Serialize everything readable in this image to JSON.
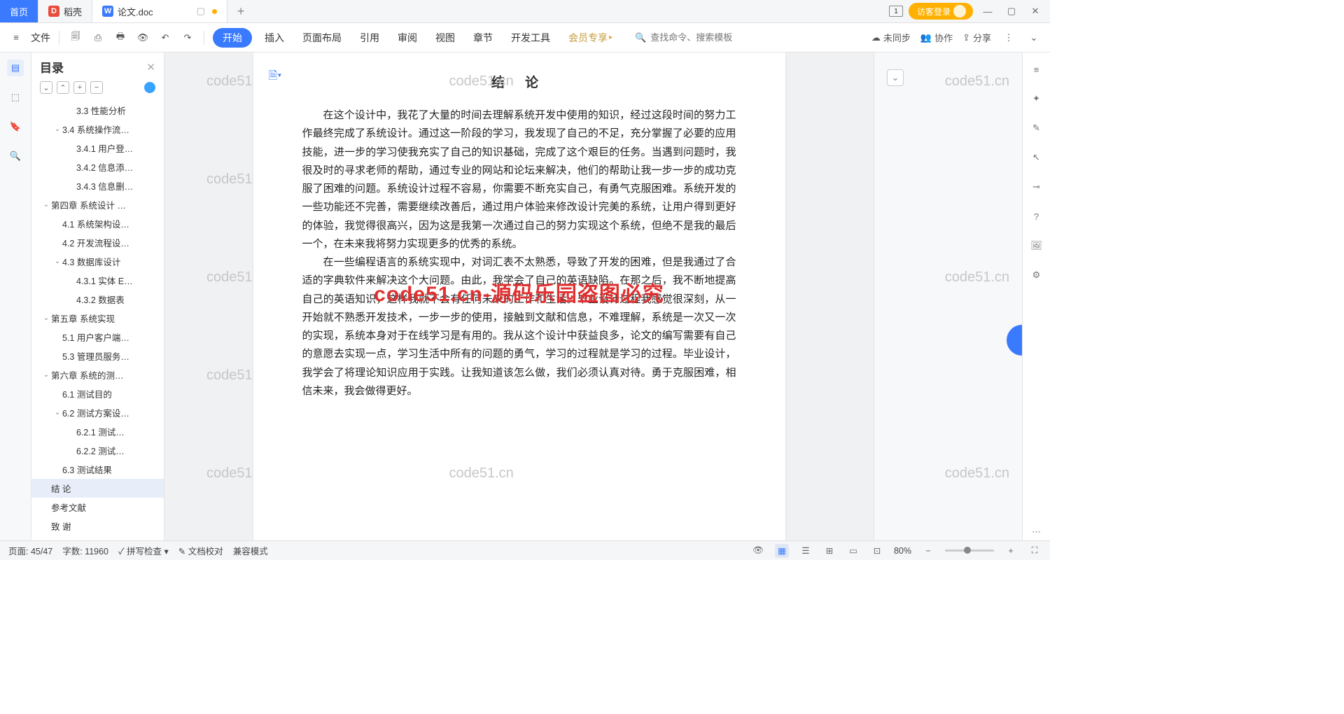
{
  "titlebar": {
    "home": "首页",
    "daoke": "稻壳",
    "docname": "论文.doc",
    "newtab": "+",
    "window_count": "1",
    "login": "访客登录"
  },
  "toolbar": {
    "file": "文件",
    "menus": [
      "开始",
      "插入",
      "页面布局",
      "引用",
      "审阅",
      "视图",
      "章节",
      "开发工具",
      "会员专享"
    ],
    "search_placeholder": "查找命令、搜索模板",
    "unsync": "未同步",
    "coop": "协作",
    "share": "分享"
  },
  "sidebar": {
    "title": "目录",
    "items": [
      {
        "lvl": 2,
        "txt": "3.3 性能分析",
        "chev": ""
      },
      {
        "lvl": 1,
        "txt": "3.4 系统操作流…",
        "chev": "⌄"
      },
      {
        "lvl": 2,
        "txt": "3.4.1 用户登…",
        "chev": ""
      },
      {
        "lvl": 2,
        "txt": "3.4.2 信息添…",
        "chev": ""
      },
      {
        "lvl": 2,
        "txt": "3.4.3 信息删…",
        "chev": ""
      },
      {
        "lvl": 0,
        "txt": "第四章  系统设计 …",
        "chev": "⌄"
      },
      {
        "lvl": 1,
        "txt": "4.1 系统架构设…",
        "chev": ""
      },
      {
        "lvl": 1,
        "txt": "4.2 开发流程设…",
        "chev": ""
      },
      {
        "lvl": 1,
        "txt": "4.3 数据库设计",
        "chev": "⌄"
      },
      {
        "lvl": 2,
        "txt": "4.3.1 实体 E…",
        "chev": ""
      },
      {
        "lvl": 2,
        "txt": "4.3.2 数据表",
        "chev": ""
      },
      {
        "lvl": 0,
        "txt": "第五章  系统实现",
        "chev": "⌄"
      },
      {
        "lvl": 1,
        "txt": "5.1 用户客户端…",
        "chev": ""
      },
      {
        "lvl": 1,
        "txt": "5.3 管理员服务…",
        "chev": ""
      },
      {
        "lvl": 0,
        "txt": "第六章   系统的测…",
        "chev": "⌄"
      },
      {
        "lvl": 1,
        "txt": "6.1 测试目的",
        "chev": ""
      },
      {
        "lvl": 1,
        "txt": "6.2 测试方案设…",
        "chev": "⌄"
      },
      {
        "lvl": 2,
        "txt": "6.2.1 测试…",
        "chev": ""
      },
      {
        "lvl": 2,
        "txt": "6.2.2 测试…",
        "chev": ""
      },
      {
        "lvl": 1,
        "txt": "6.3 测试结果",
        "chev": ""
      },
      {
        "lvl": 0,
        "txt": "结   论",
        "chev": "",
        "sel": true
      },
      {
        "lvl": 0,
        "txt": "参考文献",
        "chev": ""
      },
      {
        "lvl": 0,
        "txt": "致   谢",
        "chev": ""
      }
    ]
  },
  "document": {
    "title": "结  论",
    "p1": "在这个设计中，我花了大量的时间去理解系统开发中使用的知识，经过这段时间的努力工作最终完成了系统设计。通过这一阶段的学习，我发现了自己的不足，充分掌握了必要的应用技能，进一步的学习使我充实了自己的知识基础，完成了这个艰巨的任务。当遇到问题时，我很及时的寻求老师的帮助，通过专业的网站和论坛来解决，他们的帮助让我一步一步的成功克服了困难的问题。系统设计过程不容易，你需要不断充实自己，有勇气克服困难。系统开发的一些功能还不完善，需要继续改善后，通过用户体验来修改设计完美的系统，让用户得到更好的体验，我觉得很高兴，因为这是我第一次通过自己的努力实现这个系统，但绝不是我的最后一个，在未来我将努力实现更多的优秀的系统。",
    "p2": "在一些编程语言的系统实现中，对词汇表不太熟悉，导致了开发的困难，但是我通过了合适的字典软件来解决这个大问题。由此，我学会了自己的英语缺陷。在那之后，我不断地提高自己的英语知识，这样我就不会有任何未来的工作和生活。毕业设计过程我感觉很深刻，从一开始就不熟悉开发技术，一步一步的使用，接触到文献和信息，不难理解，系统是一次又一次的实现，系统本身对于在线学习是有用的。我从这个设计中获益良多，论文的编写需要有自己的意愿去实现一点，学习生活中所有的问题的勇气，学习的过程就是学习的过程。毕业设计，我学会了将理论知识应用于实践。让我知道该怎么做，我们必须认真对待。勇于克服困难，相信未来，我会做得更好。"
  },
  "watermark": {
    "text": "code51.cn",
    "big": "code51.cn-源码乐园盗图必究"
  },
  "status": {
    "page": "页面: 45/47",
    "words": "字数: 11960",
    "spell": "拼写检查",
    "proof": "文档校对",
    "compat": "兼容模式",
    "zoom": "80%"
  }
}
